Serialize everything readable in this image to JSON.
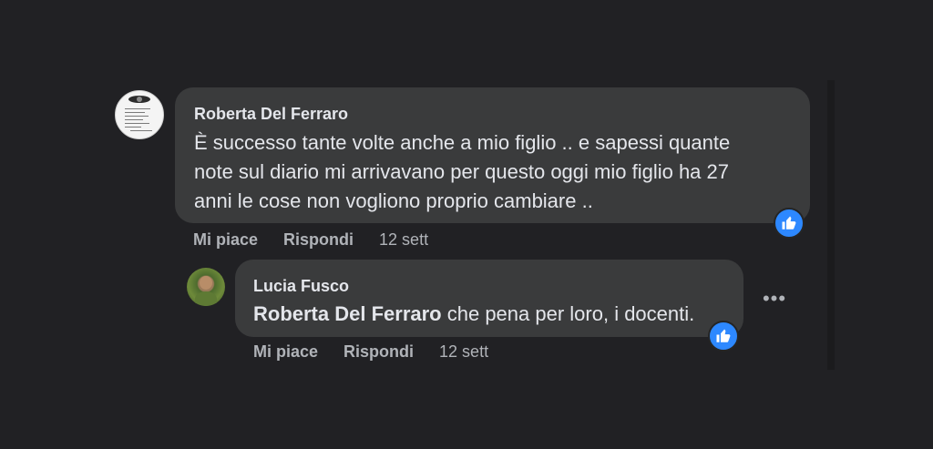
{
  "comments": [
    {
      "author": "Roberta Del Ferraro",
      "text": "È successo tante volte anche a mio figlio .. e sapessi quante note sul diario mi arrivavano per questo oggi mio figlio ha 27 anni le cose non vogliono proprio cambiare ..",
      "lines": [
        "È successo tante volte anche a mio figlio .. e sapessi quante",
        "note sul diario mi arrivavano per questo oggi mio figlio ha 27",
        "anni le cose non vogliono proprio cambiare .."
      ],
      "like_label": "Mi piace",
      "reply_label": "Rispondi",
      "timestamp": "12 sett",
      "reaction_icon": "like-reaction-icon"
    }
  ],
  "reply": {
    "author": "Lucia Fusco",
    "mention": "Roberta Del Ferraro",
    "text": " che pena per loro, i docenti.",
    "like_label": "Mi piace",
    "reply_label": "Rispondi",
    "timestamp": "12 sett",
    "reaction_icon": "like-reaction-icon",
    "more_icon": "more-options-icon",
    "more_label": "•••"
  },
  "colors": {
    "background": "#212124",
    "bubble": "#3a3b3c",
    "primary_text": "#e4e6eb",
    "secondary_text": "#b0b3b8",
    "like_blue": "#2d88ff"
  }
}
